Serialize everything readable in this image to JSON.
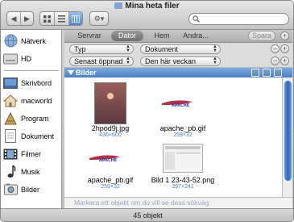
{
  "window": {
    "title": "Mina heta filer"
  },
  "toolbar": {
    "back_icon": "back-arrow-icon",
    "forward_icon": "forward-arrow-icon",
    "action_label": "⚙▾",
    "search_placeholder": ""
  },
  "sidebar": {
    "devices": [
      {
        "label": "Nätverk",
        "icon": "network-globe-icon"
      },
      {
        "label": "HD",
        "icon": "hard-drive-icon"
      }
    ],
    "places": [
      {
        "label": "Skrivbord",
        "icon": "desktop-icon"
      },
      {
        "label": "macworld",
        "icon": "home-icon"
      },
      {
        "label": "Program",
        "icon": "applications-icon"
      },
      {
        "label": "Dokument",
        "icon": "documents-icon"
      },
      {
        "label": "Filmer",
        "icon": "movies-icon"
      },
      {
        "label": "Musik",
        "icon": "music-icon"
      },
      {
        "label": "Bilder",
        "icon": "pictures-icon"
      }
    ]
  },
  "scope": {
    "tabs": [
      "Servrar",
      "Dator",
      "Hem",
      "Andra..."
    ],
    "active_tab": "Dator",
    "save_label": "Spara"
  },
  "criteria": [
    {
      "attribute": "Typ",
      "value": "Dokument"
    },
    {
      "attribute": "Senast öppnad",
      "value": "Den här veckan"
    }
  ],
  "group": {
    "title": "Bilder"
  },
  "files": [
    {
      "name": "2hpod9j.jpg",
      "size": "436×600"
    },
    {
      "name": "apache_pb.gif",
      "size": "259×32"
    },
    {
      "name": "apache_pb.gif",
      "size": "259×32"
    },
    {
      "name": "Bild 1 23-43-52.png",
      "size": "397×241"
    }
  ],
  "path_hint": "Markera ett objekt om du vill se dess sökväg.",
  "status": {
    "count": "45 objekt"
  },
  "colors": {
    "accent": "#4b7ec2",
    "group_bar": "#6f9cd6",
    "size_text": "#4a7cc0"
  }
}
